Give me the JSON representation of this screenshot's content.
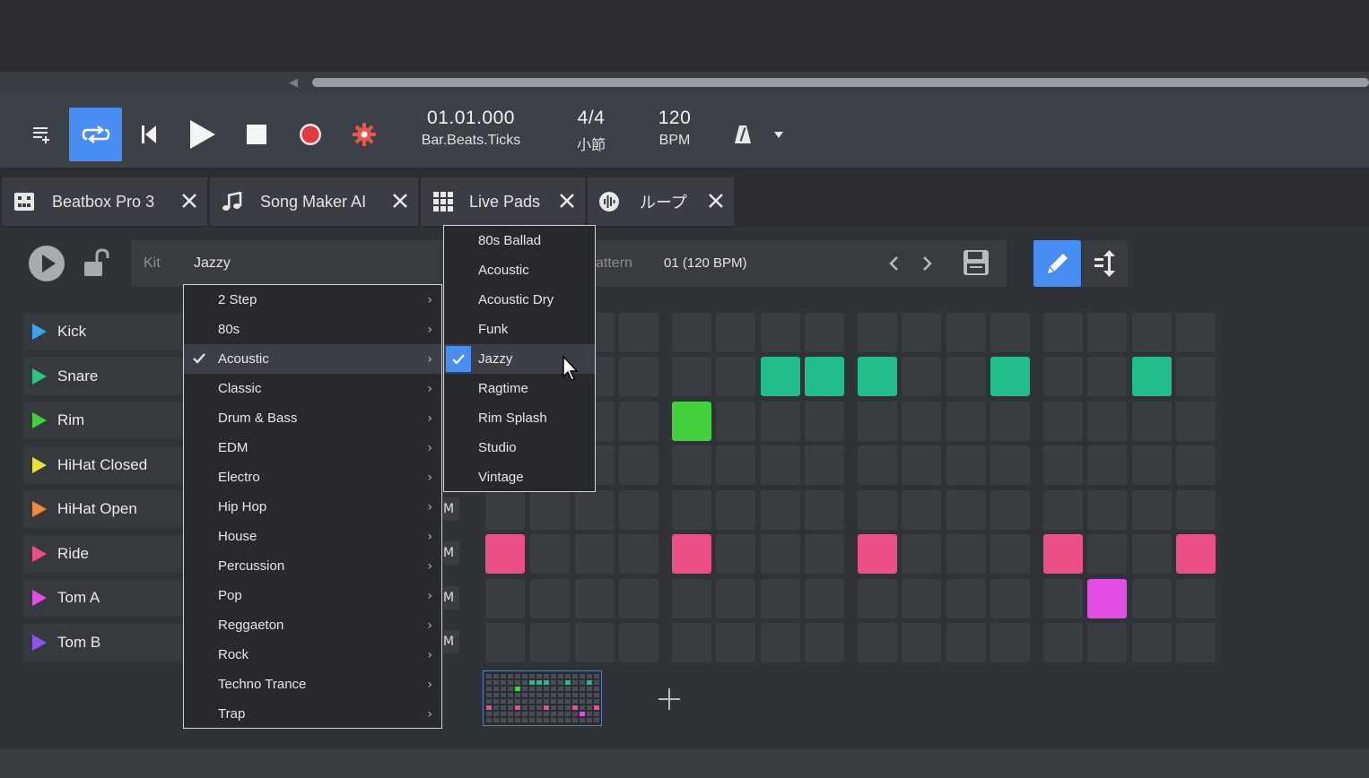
{
  "transport": {
    "position": "01.01.000",
    "position_label": "Bar.Beats.Ticks",
    "time_sig": "4/4",
    "time_sig_label": "小節",
    "tempo": "120",
    "tempo_label": "BPM"
  },
  "tabs": [
    {
      "label": "Beatbox Pro 3"
    },
    {
      "label": "Song Maker AI"
    },
    {
      "label": "Live Pads"
    },
    {
      "label": "ループ"
    }
  ],
  "toolbar": {
    "kit_label": "Kit",
    "kit_value": "Jazzy",
    "pattern_label": "attern",
    "pattern_value": "01 (120 BPM)"
  },
  "tracks": [
    {
      "name": "Kick",
      "color": "#3aa3ee"
    },
    {
      "name": "Snare",
      "color": "#2cc47e"
    },
    {
      "name": "Rim",
      "color": "#43d23e"
    },
    {
      "name": "HiHat Closed",
      "color": "#e8e23a"
    },
    {
      "name": "HiHat Open",
      "color": "#ee8a3a"
    },
    {
      "name": "Ride",
      "color": "#ec4f85"
    },
    {
      "name": "Tom A",
      "color": "#e24ee4"
    },
    {
      "name": "Tom B",
      "color": "#8a54ee"
    }
  ],
  "track_mute_labels": [
    "M",
    "M",
    "M",
    "M"
  ],
  "genre_menu": {
    "items": [
      "2 Step",
      "80s",
      "Acoustic",
      "Classic",
      "Drum & Bass",
      "EDM",
      "Electro",
      "Hip Hop",
      "House",
      "Percussion",
      "Pop",
      "Reggaeton",
      "Rock",
      "Techno Trance",
      "Trap"
    ],
    "checked": "Acoustic"
  },
  "kit_submenu": {
    "items": [
      "80s Ballad",
      "Acoustic",
      "Acoustic Dry",
      "Funk",
      "Jazzy",
      "Ragtime",
      "Rim Splash",
      "Studio",
      "Vintage"
    ],
    "checked": "Jazzy"
  },
  "colors": {
    "accent": "#4a8df2",
    "snare_on": "#21bd8a",
    "rim_on": "#43d23e",
    "ride_on": "#ec4f85",
    "toma_on": "#e24ee4"
  }
}
